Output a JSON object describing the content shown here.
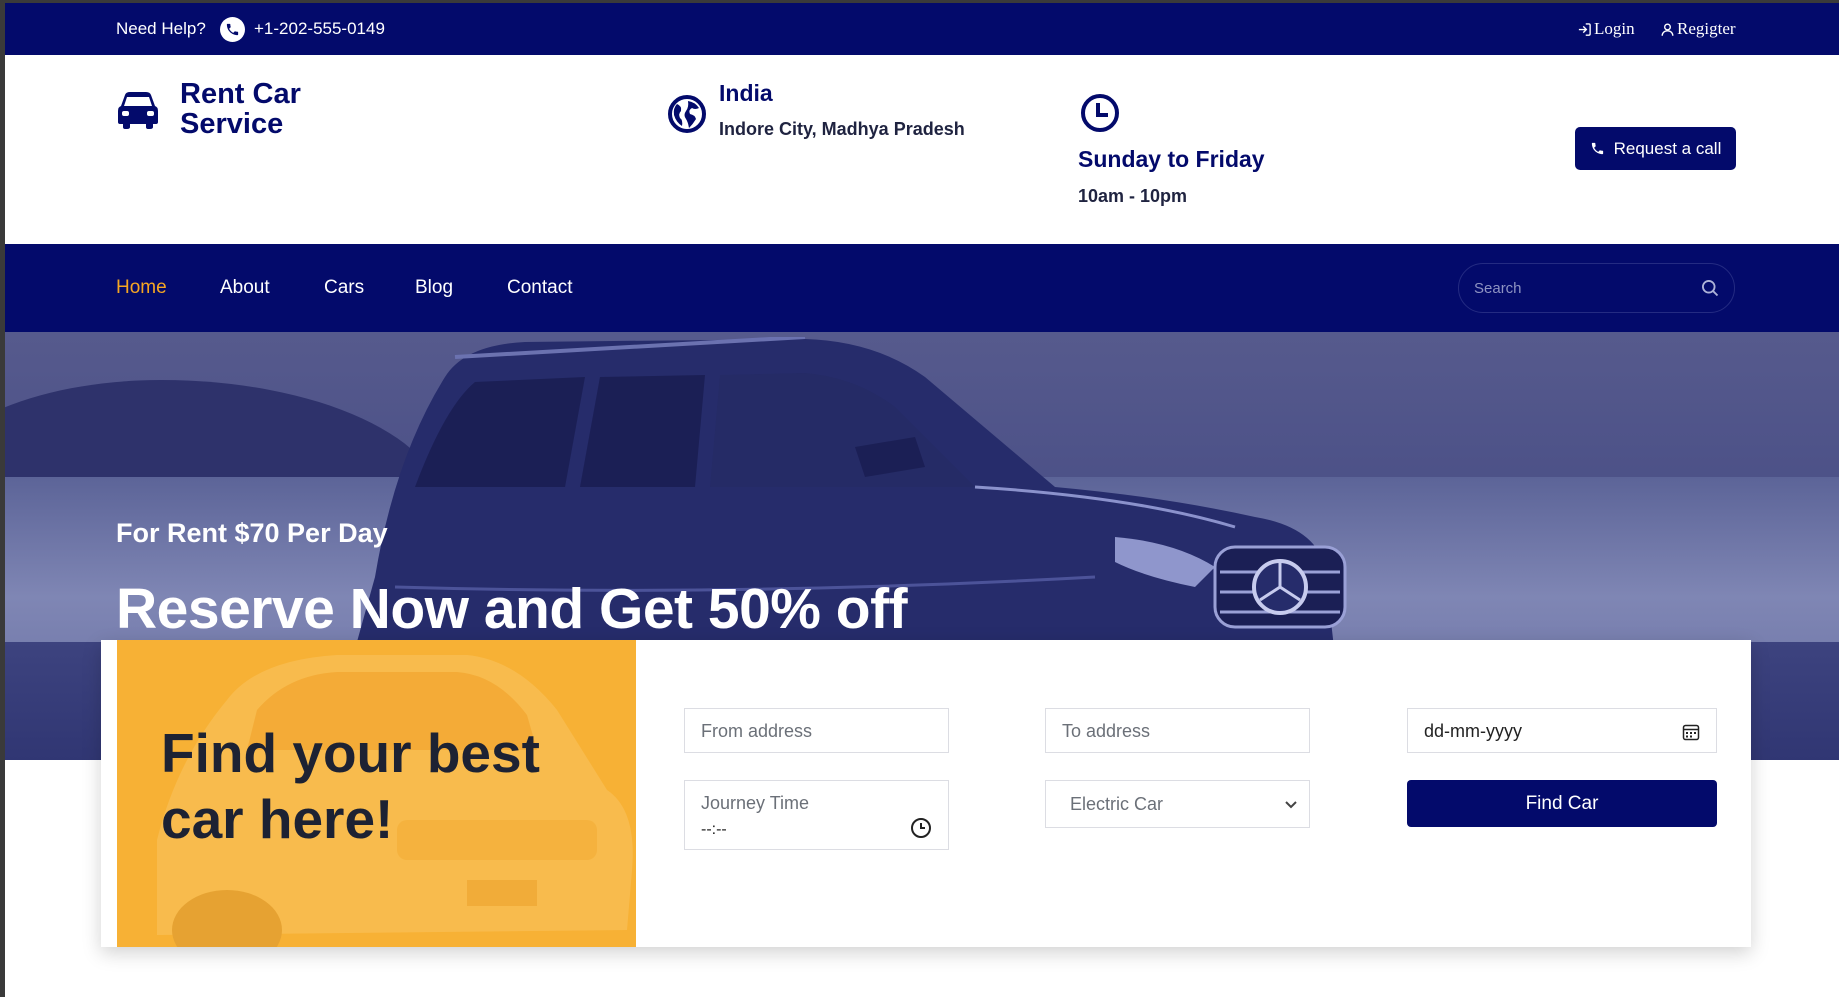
{
  "topbar": {
    "help_label": "Need Help?",
    "phone": "+1-202-555-0149",
    "login_label": "Login",
    "register_label": "Regigter"
  },
  "header": {
    "brand_line1": "Rent Car",
    "brand_line2": "Service",
    "location_country": "India",
    "location_city": "Indore City, Madhya Pradesh",
    "hours_title": "Sunday to Friday",
    "hours_time": "10am - 10pm",
    "request_call_label": "Request a call"
  },
  "nav": {
    "items": [
      {
        "label": "Home",
        "active": true
      },
      {
        "label": "About",
        "active": false
      },
      {
        "label": "Cars",
        "active": false
      },
      {
        "label": "Blog",
        "active": false
      },
      {
        "label": "Contact",
        "active": false
      }
    ],
    "search_placeholder": "Search"
  },
  "hero": {
    "subtitle": "For Rent $70 Per Day",
    "title": "Reserve Now and Get 50% off"
  },
  "booking": {
    "promo_text": "Find your best car here!",
    "from_placeholder": "From address",
    "to_placeholder": "To address",
    "date_placeholder": "dd-mm-yyyy",
    "journey_time_label": "Journey Time",
    "journey_time_value": "--:--",
    "car_type_selected": "Electric Car",
    "find_button_label": "Find Car"
  },
  "colors": {
    "primary": "#030a6b",
    "accent": "#f5a623",
    "promo_bg": "#f7b135"
  }
}
